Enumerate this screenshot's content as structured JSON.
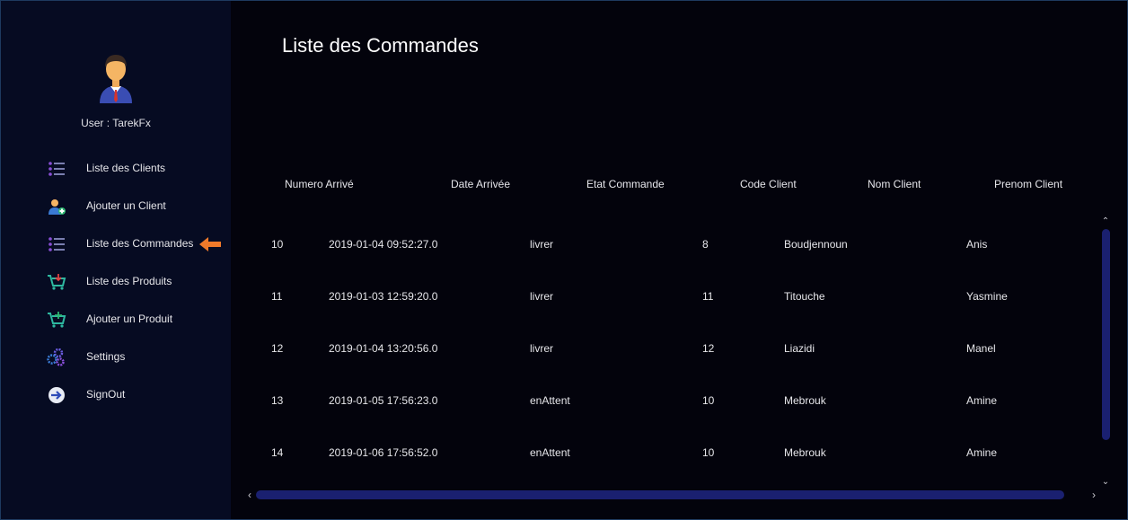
{
  "sidebar": {
    "user_label": "User : TarekFx",
    "items": [
      {
        "label": "Liste des Clients",
        "icon": "list-icon"
      },
      {
        "label": "Ajouter un Client",
        "icon": "add-user-icon"
      },
      {
        "label": "Liste des Commandes",
        "icon": "list-icon",
        "active": true
      },
      {
        "label": "Liste des Produits",
        "icon": "cart-icon"
      },
      {
        "label": "Ajouter un Produit",
        "icon": "cart-add-icon"
      },
      {
        "label": "Settings",
        "icon": "gears-icon"
      },
      {
        "label": "SignOut",
        "icon": "signout-icon"
      }
    ]
  },
  "main": {
    "title": "Liste des Commandes",
    "columns": [
      "Numero Arrivé",
      "Date Arrivée",
      "Etat Commande",
      "Code Client",
      "Nom Client",
      "Prenom Client"
    ],
    "rows": [
      [
        "10",
        "2019-01-04 09:52:27.0",
        "livrer",
        "8",
        "Boudjennoun",
        "Anis"
      ],
      [
        "11",
        "2019-01-03 12:59:20.0",
        "livrer",
        "11",
        "Titouche",
        "Yasmine"
      ],
      [
        "12",
        "2019-01-04 13:20:56.0",
        "livrer",
        "12",
        "Liazidi",
        "Manel"
      ],
      [
        "13",
        "2019-01-05 17:56:23.0",
        "enAttent",
        "10",
        "Mebrouk",
        "Amine"
      ],
      [
        "14",
        "2019-01-06 17:56:52.0",
        "enAttent",
        "10",
        "Mebrouk",
        "Amine"
      ]
    ]
  },
  "colors": {
    "sidebar_bg": "#060b22",
    "main_bg": "#03030c",
    "scrollbar": "#1a2070",
    "accent_arrow": "#f07a2a"
  }
}
